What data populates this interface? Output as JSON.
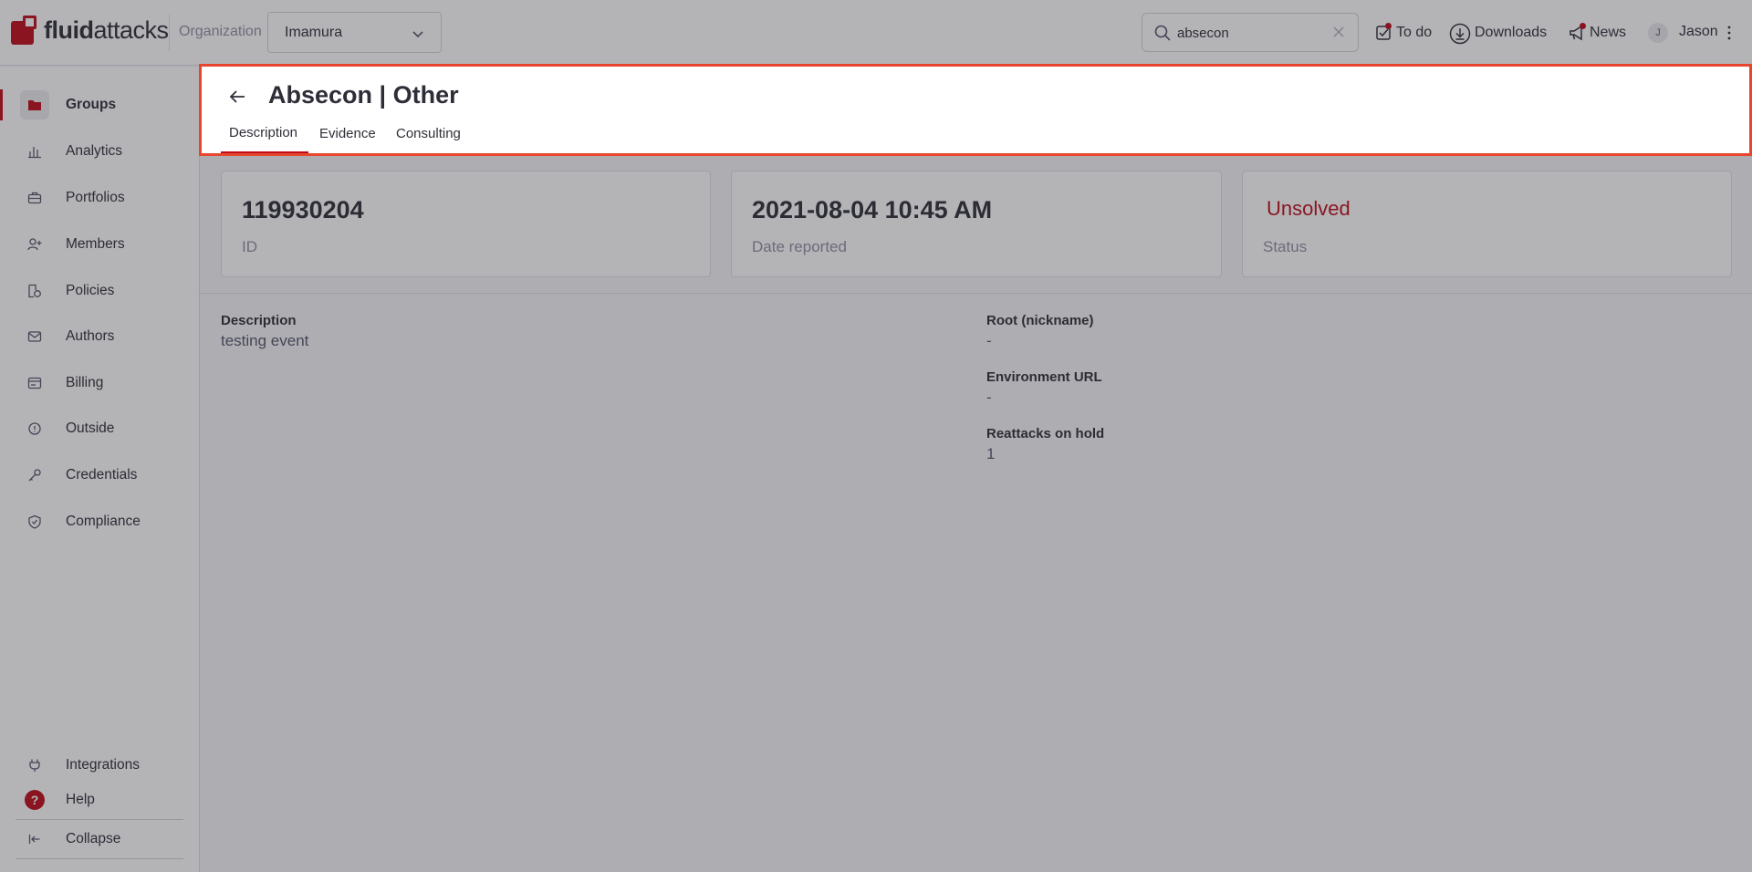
{
  "topbar": {
    "logo_bold": "fluid",
    "logo_regular": "attacks",
    "org_label": "Organization",
    "org_value": "Imamura",
    "search_value": "absecon",
    "todo_label": "To do",
    "downloads_label": "Downloads",
    "news_label": "News",
    "avatar_initial": "J",
    "user_name": "Jason"
  },
  "sidebar": {
    "items": [
      {
        "label": "Groups",
        "icon": "folder-icon",
        "active": true
      },
      {
        "label": "Analytics",
        "icon": "bar-chart-icon"
      },
      {
        "label": "Portfolios",
        "icon": "briefcase-icon"
      },
      {
        "label": "Members",
        "icon": "user-plus-icon"
      },
      {
        "label": "Policies",
        "icon": "policy-icon"
      },
      {
        "label": "Authors",
        "icon": "mail-icon"
      },
      {
        "label": "Billing",
        "icon": "billing-icon"
      },
      {
        "label": "Outside",
        "icon": "info-circle-icon"
      },
      {
        "label": "Credentials",
        "icon": "key-icon"
      },
      {
        "label": "Compliance",
        "icon": "shield-icon"
      }
    ],
    "bottom": {
      "integrations": "Integrations",
      "help": "Help",
      "help_glyph": "?",
      "collapse": "Collapse"
    }
  },
  "header": {
    "title": "Absecon | Other",
    "tabs": [
      "Description",
      "Evidence",
      "Consulting"
    ],
    "active_tab": "Description"
  },
  "cards": [
    {
      "value": "119930204",
      "label": "ID"
    },
    {
      "value": "2021-08-04 10:45 AM",
      "label": "Date reported"
    },
    {
      "value": "Unsolved",
      "label": "Status"
    }
  ],
  "details": {
    "description_label": "Description",
    "description_value": "testing event",
    "root_label": "Root (nickname)",
    "root_value": "-",
    "env_label": "Environment URL",
    "env_value": "-",
    "reattacks_label": "Reattacks on hold",
    "reattacks_value": "1"
  },
  "colors": {
    "brand": "#bf0b1a",
    "highlight": "#e8452e"
  }
}
